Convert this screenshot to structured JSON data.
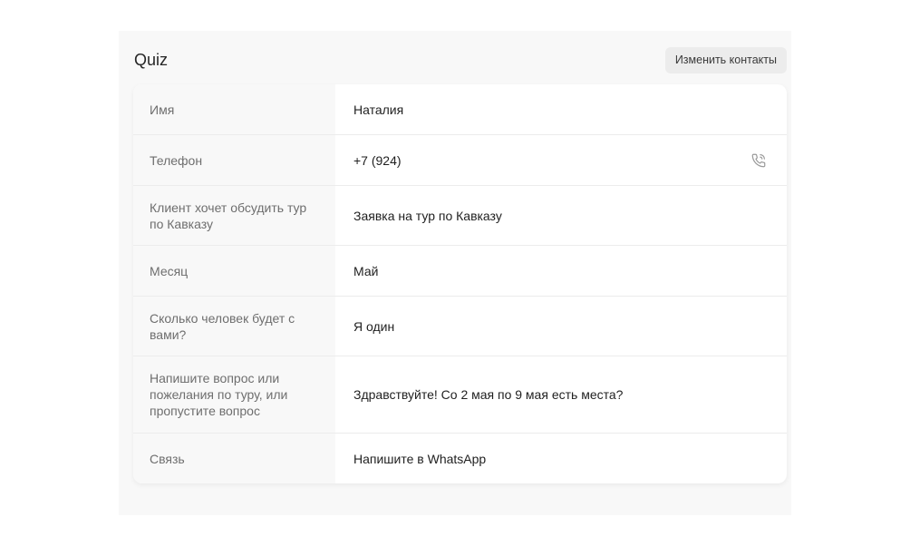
{
  "header": {
    "title": "Quiz",
    "edit_button_label": "Изменить контакты"
  },
  "rows": [
    {
      "label": "Имя",
      "value": "Наталия"
    },
    {
      "label": "Телефон",
      "value": "+7 (924)",
      "icon": "phone-call-icon"
    },
    {
      "label": "Клиент хочет обсудить тур по Кавказу",
      "value": "Заявка на тур по Кавказу"
    },
    {
      "label": "Месяц",
      "value": "Май"
    },
    {
      "label": "Сколько человек будет с вами?",
      "value": "Я один"
    },
    {
      "label": "Напишите вопрос или пожелания по туру, или пропустите вопрос",
      "value": "Здравствуйте! Со 2 мая по 9 мая есть места?"
    },
    {
      "label": "Связь",
      "value": "Напишите в WhatsApp"
    }
  ],
  "colors": {
    "panel_bg": "#f8f8f8",
    "card_bg": "#ffffff",
    "label_text": "#6e6e6e",
    "value_text": "#1f1f1f",
    "icon": "#9a9a9a"
  }
}
